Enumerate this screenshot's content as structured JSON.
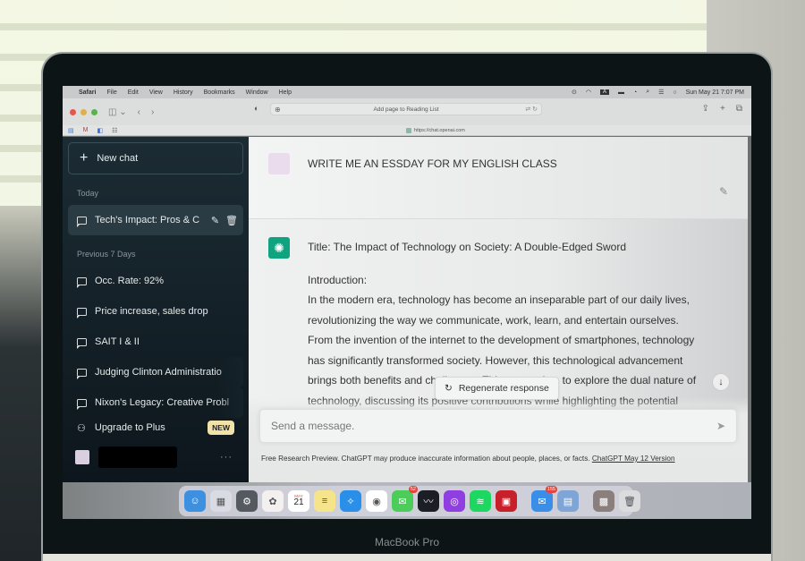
{
  "menubar": {
    "apple_icon": "apple-icon",
    "items": [
      "Safari",
      "File",
      "Edit",
      "View",
      "History",
      "Bookmarks",
      "Window",
      "Help"
    ],
    "status_badge": "A",
    "clock": "Sun May 21  7:07 PM"
  },
  "safari": {
    "address_text": "Add page to Reading List",
    "url": "https://chat.openai.com"
  },
  "sidebar": {
    "new_chat_label": "New chat",
    "today_label": "Today",
    "today_items": [
      {
        "title": "Tech's Impact: Pros & C"
      }
    ],
    "previous_label": "Previous 7 Days",
    "previous_items": [
      {
        "title": "Occ. Rate: 92%"
      },
      {
        "title": "Price increase, sales drop"
      },
      {
        "title": "SAIT I & II"
      },
      {
        "title": "Judging Clinton Administratio"
      },
      {
        "title": "Nixon's Legacy: Creative Probl"
      }
    ],
    "upgrade_label": "Upgrade to Plus",
    "upgrade_badge": "NEW",
    "user_menu": "···"
  },
  "conversation": {
    "user_message": "WRITE ME AN ESSDAY FOR MY ENGLISH CLASS",
    "assistant": {
      "title_line": "Title: The Impact of Technology on Society: A Double-Edged Sword",
      "intro_label": "Introduction:",
      "lines": [
        "In the modern era, technology has become an inseparable part of our daily lives,",
        "revolutionizing the way we communicate, work, learn, and entertain ourselves.",
        "From the invention of the internet to the development of smartphones, technology",
        "has significantly transformed society. However, this technological advancement",
        "brings both benefits and challenges. This essay aims to explore the dual nature of",
        "technology, discussing its positive contributions while highlighting the potential"
      ]
    },
    "regenerate_label": "Regenerate response"
  },
  "composer": {
    "placeholder": "Send a message.",
    "disclaimer": "Free Research Preview. ChatGPT may produce inaccurate information about people, places, or facts.",
    "version_link": "ChatGPT May 12 Version"
  },
  "dock": {
    "apps": [
      {
        "name": "Finder",
        "color": "#3d8fe0",
        "glyph": "☺"
      },
      {
        "name": "Launchpad",
        "color": "#d8dbe3",
        "glyph": "▦"
      },
      {
        "name": "System Settings",
        "color": "#555a60",
        "glyph": "⚙"
      },
      {
        "name": "Photos",
        "color": "#f4f0f0",
        "glyph": "✿"
      },
      {
        "name": "Calendar",
        "month": "MAY",
        "day": "21"
      },
      {
        "name": "Notes",
        "color": "#f6e48a",
        "glyph": "≡"
      },
      {
        "name": "Safari",
        "color": "#2a8fe8",
        "glyph": "✧"
      },
      {
        "name": "Chrome",
        "color": "#ffffff",
        "glyph": "◉"
      },
      {
        "name": "Messages",
        "color": "#4ccd5a",
        "glyph": "✉",
        "badge": "52"
      },
      {
        "name": "Stocks",
        "color": "#1b1e24",
        "glyph": "〰"
      },
      {
        "name": "Podcasts",
        "color": "#8f3ee0",
        "glyph": "◎"
      },
      {
        "name": "Spotify",
        "color": "#1ed760",
        "glyph": "≋"
      },
      {
        "name": "Photo Booth",
        "color": "#c8202a",
        "glyph": "▣"
      }
    ],
    "apps2": [
      {
        "name": "Mail",
        "color": "#3a8ee8",
        "glyph": "✉",
        "badge": "155"
      },
      {
        "name": "Preview",
        "color": "#7ea5d6",
        "glyph": "▤"
      }
    ],
    "stack": {
      "name": "Downloads stack",
      "color": "#8b7f7d",
      "glyph": "▩"
    },
    "trash": {
      "name": "Trash",
      "color": "#d9dbdd",
      "glyph": "🗑"
    }
  },
  "device": {
    "brand": "MacBook Pro"
  }
}
